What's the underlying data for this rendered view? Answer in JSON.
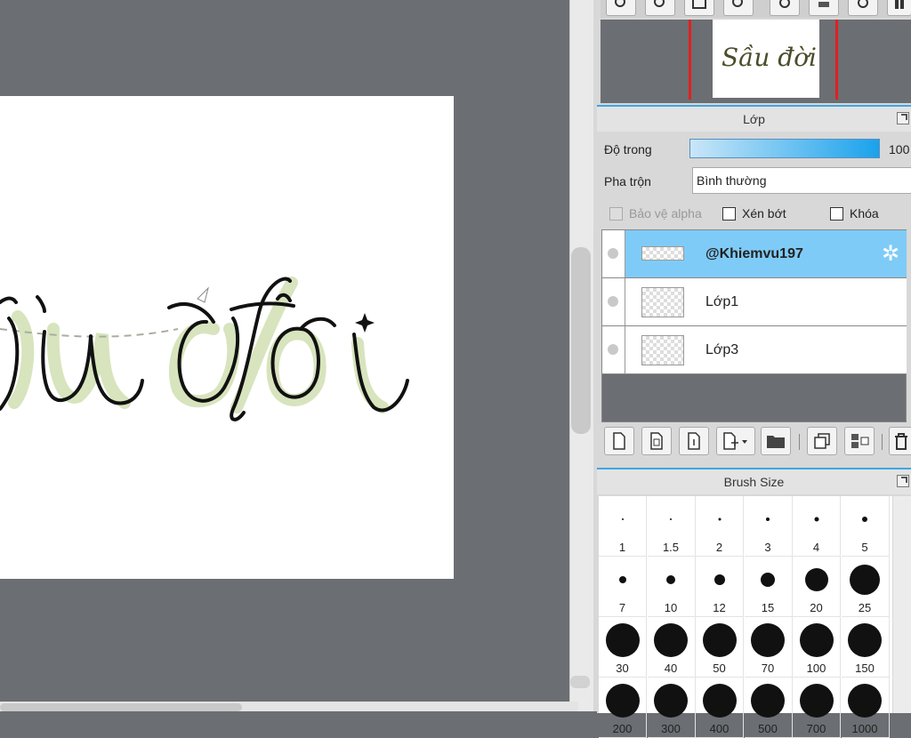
{
  "canvas": {
    "artwork_text": "ồu đời",
    "colors": {
      "ink": "#111111",
      "shadow": "#d7e4bd",
      "dashes": "#a8ae9e",
      "paper": "#ffffff",
      "workspace": "#6b6e72"
    }
  },
  "navigator": {
    "thumb_text": "Sầu đời"
  },
  "layer_panel": {
    "title": "Lớp",
    "opacity_label": "Độ trong",
    "opacity_value": "100",
    "opacity_fraction": 1.0,
    "blend_label": "Pha trộn",
    "blend_value": "Bình thường",
    "checkboxes": {
      "protect_alpha": "Bảo vệ alpha",
      "clipping": "Xén bớt",
      "lock": "Khóa"
    },
    "layers": [
      {
        "name": "@Khiemvu197",
        "selected": true
      },
      {
        "name": "Lớp1",
        "selected": false
      },
      {
        "name": "Lớp3",
        "selected": false
      }
    ],
    "accent_color": "#7fcbf7"
  },
  "brush_panel": {
    "title": "Brush Size",
    "sizes": [
      "1",
      "1.5",
      "2",
      "3",
      "4",
      "5",
      "7",
      "10",
      "12",
      "15",
      "20",
      "25",
      "30",
      "40",
      "50",
      "70",
      "100",
      "150",
      "200",
      "300",
      "400",
      "500",
      "700",
      "1000"
    ]
  },
  "icons": {
    "nav_toolbar": [
      "zoom-in-icon",
      "zoom-fit-icon",
      "fullscreen-icon",
      "zoom-out-icon",
      "rotate-ccw-icon",
      "flip-icon",
      "rotate-cw-icon",
      "more-icon"
    ],
    "layer_tools": [
      "new-layer-icon",
      "new-8bit-layer-icon",
      "new-1bit-layer-icon",
      "add-layer-dropdown-icon",
      "new-folder-icon",
      "duplicate-layer-icon",
      "merge-layer-icon",
      "delete-layer-icon"
    ]
  }
}
